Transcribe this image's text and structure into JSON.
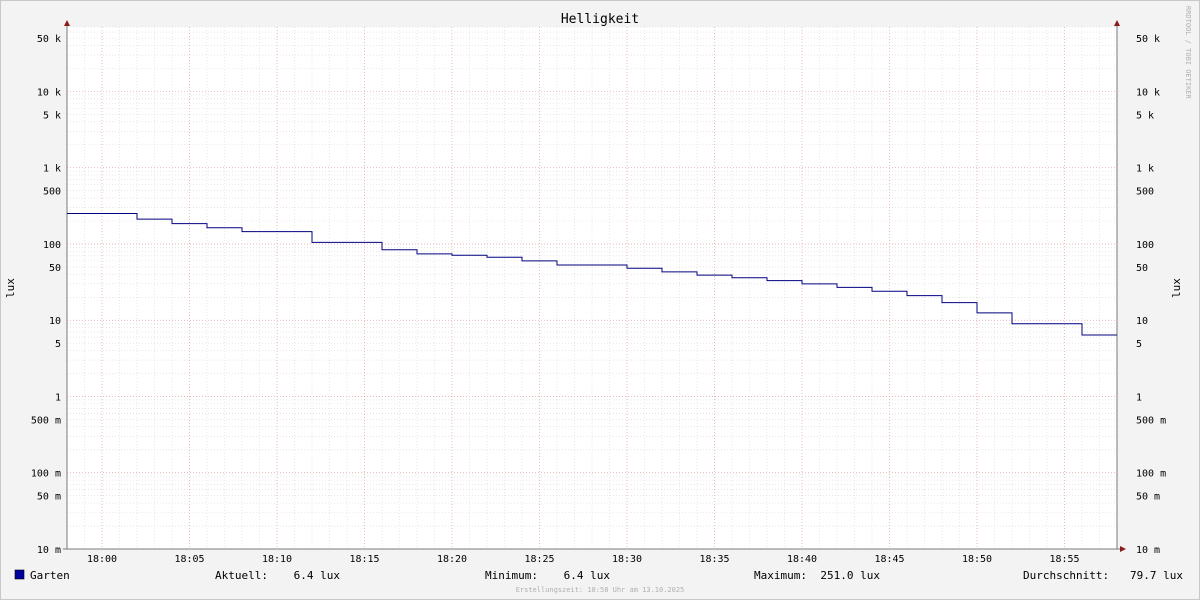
{
  "chart_data": {
    "type": "line",
    "title": "Helligkeit",
    "ylabel": "lux",
    "y_scale": "log",
    "ylim": [
      0.01,
      70000
    ],
    "xlim": [
      "17:58",
      "18:58"
    ],
    "grid": true,
    "y_ticks": [
      {
        "value": 0.01,
        "label": "10 m"
      },
      {
        "value": 0.05,
        "label": "50 m"
      },
      {
        "value": 0.1,
        "label": "100 m"
      },
      {
        "value": 0.5,
        "label": "500 m"
      },
      {
        "value": 1,
        "label": "1"
      },
      {
        "value": 5,
        "label": "5"
      },
      {
        "value": 10,
        "label": "10"
      },
      {
        "value": 50,
        "label": "50"
      },
      {
        "value": 100,
        "label": "100"
      },
      {
        "value": 500,
        "label": "500"
      },
      {
        "value": 1000,
        "label": "1 k"
      },
      {
        "value": 5000,
        "label": "5 k"
      },
      {
        "value": 10000,
        "label": "10 k"
      },
      {
        "value": 50000,
        "label": "50 k"
      }
    ],
    "x_ticks": [
      "18:00",
      "18:05",
      "18:10",
      "18:15",
      "18:20",
      "18:25",
      "18:30",
      "18:35",
      "18:40",
      "18:45",
      "18:50",
      "18:55"
    ],
    "series": [
      {
        "name": "Garten",
        "color": "#000080",
        "step": true,
        "x": [
          "17:58",
          "18:02",
          "18:04",
          "18:06",
          "18:08",
          "18:12",
          "18:16",
          "18:18",
          "18:20",
          "18:22",
          "18:24",
          "18:26",
          "18:30",
          "18:32",
          "18:34",
          "18:36",
          "18:38",
          "18:40",
          "18:42",
          "18:44",
          "18:46",
          "18:48",
          "18:50",
          "18:52",
          "18:56",
          "18:58"
        ],
        "values": [
          251,
          212,
          185,
          163,
          145,
          105,
          84,
          74,
          71,
          67,
          60,
          53,
          48,
          43,
          39,
          36,
          33,
          30,
          27,
          24,
          21,
          17,
          12.5,
          9,
          6.4,
          6.4
        ]
      }
    ]
  },
  "legend": {
    "series_name": "Garten",
    "swatch_color": "#0000a0",
    "stats": [
      {
        "label": "Aktuell:",
        "value": "6.4 lux"
      },
      {
        "label": "Minimum:",
        "value": "6.4 lux"
      },
      {
        "label": "Maximum:",
        "value": "251.0 lux"
      },
      {
        "label": "Durchschnitt:",
        "value": "79.7 lux"
      }
    ]
  },
  "footer": "Erstellungszeit: 18:58 Uhr am 13.10.2025",
  "watermark": "RRDTOOL / TOBI OETIKER",
  "colors": {
    "background": "#f3f3f3",
    "canvas": "#ffffff",
    "grid_major": "#e8a0a0",
    "grid_minor": "#d8d8d8",
    "axis": "#7a7a7a",
    "arrow": "#8b1a1a",
    "text": "#000000",
    "muted_text": "#b0b0b0"
  }
}
